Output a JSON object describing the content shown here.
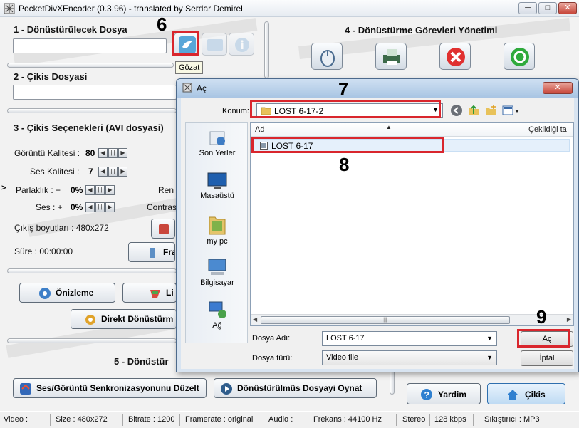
{
  "window": {
    "title": "PocketDivXEncoder (0.3.96) - translated by Serdar Demirel",
    "minimize": "─",
    "maximize": "□",
    "close": "✕"
  },
  "sections": {
    "s1": "1 - Dönüstürülecek Dosya",
    "s2": "2 - Çikis Dosyasi",
    "s3": "3 - Çikis Seçenekleri (AVI dosyasi)",
    "s4": "4 - Dönüstürme Görevleri Yönetimi",
    "s5": "5 - Dönüstür"
  },
  "options": {
    "video_quality_label": "Görüntü Kalitesi :",
    "video_quality_value": "80",
    "audio_quality_label": "Ses Kalitesi :",
    "audio_quality_value": "7",
    "brightness_label": "Parlaklık : +",
    "brightness_value": "0%",
    "volume_label": "Ses : +",
    "volume_value": "0%",
    "color_label": "Ren",
    "contrast_label": "Contras",
    "output_size": "Çıkış boyutları : 480x272",
    "duration": "Süre : 00:00:00"
  },
  "buttons": {
    "frame_partial": "Fra",
    "preview": "Önizleme",
    "list_partial": "Li",
    "direct_convert": "Direkt Dönüstürm",
    "av_sync": "Ses/Görüntü Senkronizasyonunu Düzelt",
    "play_converted": "Dönüstürülmüs Dosyayi Oynat",
    "help": "Yardim",
    "exit": "Çikis"
  },
  "tooltip": "Gözat",
  "callouts": [
    "6",
    "7",
    "8",
    "9"
  ],
  "statusbar": {
    "video": "Video :",
    "size": "Size : 480x272",
    "bitrate": "Bitrate : 1200",
    "framerate": "Framerate : original",
    "audio": "Audio :",
    "frequency": "Frekans : 44100 Hz",
    "channels": "Stereo",
    "audio_bitrate": "128 kbps",
    "compressor": "Sıkıştırıcı : MP3"
  },
  "dialog": {
    "title": "Aç",
    "close": "✕",
    "location_label": "Konum:",
    "location_value": "LOST 6-17-2",
    "places": [
      "Son Yerler",
      "Masaüstü",
      "my pc",
      "Bilgisayar",
      "Ağ"
    ],
    "columns": {
      "name": "Ad",
      "date": "Çekildiği ta"
    },
    "files": [
      "LOST 6-17"
    ],
    "filename_label": "Dosya Adı:",
    "filename_value": "LOST 6-17",
    "filetype_label": "Dosya türü:",
    "filetype_value": "Video file",
    "open_button": "Aç",
    "cancel_button": "İptal"
  },
  "icons": {
    "browse": "bird-icon",
    "task_add": "mouse-icon",
    "task_convert": "printer-icon",
    "task_delete": "cross-icon",
    "task_start": "refresh-icon"
  },
  "colors": {
    "highlight_box": "#d9262d",
    "delete_red": "#e03030",
    "start_green": "#2faa3c"
  }
}
